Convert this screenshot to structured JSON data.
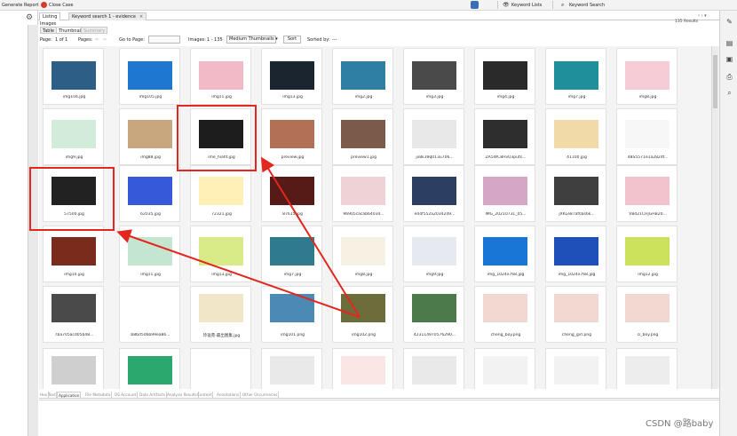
{
  "toolbar": {
    "generate_report": "Generate Report",
    "close_case": "Close Case",
    "keyword_lists": "Keyword Lists",
    "keyword_search": "Keyword Search"
  },
  "tabs": [
    {
      "label": "Listing"
    },
    {
      "label": "Keyword search 1 - evidence"
    }
  ],
  "tab_close": "×",
  "section_label": "Images",
  "right_info": "135 Results",
  "nav_arrows": "‹ ›  ▾",
  "subtabs": [
    "Table",
    "Thumbnail",
    "Summary"
  ],
  "controls": {
    "page_label": "Page:",
    "page_value": "1 of 1",
    "pages_label": "Pages:",
    "goto_label": "Go to Page:",
    "images_label": "Images:",
    "images_value": "1 - 135",
    "size_select": "Medium Thumbnails",
    "sort_button": "Sort",
    "sorted_by_label": "Sorted by:",
    "sorted_by_value": "---"
  },
  "captions": [
    [
      "img104.jpg",
      "img105.jpg",
      "img11.jpg",
      "img13.jpg",
      "img2.jpg",
      "img3.jpg",
      "img4.jpg",
      "img7.jpg",
      "img8.jpg"
    ],
    [
      "img9.jpg",
      "img88.jpg",
      "ime_hiaht.jpg",
      "preview.jpg",
      "preview1.jpg",
      "jx8k39q013u706...",
      "ZA5WC8HvU3puts...",
      "41100.jpg",
      "48S5571e1a282df..."
    ],
    [
      "57500.jpg",
      "62035.jpg",
      "72321.jpg",
      "87615.jpg",
      "96905cacab64034...",
      "e44f552a2034249...",
      "IMG_20210731_05...",
      "jXKLe87af0as6k...",
      "VBd21CHjGHB20..."
    ],
    [
      "img10.jpg",
      "img11.jpg",
      "img13.jpg",
      "img7.jpg",
      "img8.jpg",
      "img9.jpg",
      "img_1024x768.jpg",
      "img_1024x768.jpg",
      "img12.jpg"
    ],
    [
      "7ba705acd05b48...",
      "b8bd5d6b99ea86...",
      "玲珑苑-最出图集.jpg",
      "img101.png",
      "img102.png",
      "423114970576290...",
      "cheng_boy.png",
      "cheng_girl.png",
      "ci_boy.png"
    ],
    [
      "",
      "",
      "",
      "",
      "",
      "",
      "",
      "",
      ""
    ]
  ],
  "thumb_colors": [
    [
      "#2d5f86",
      "#1e78d2",
      "#f2b9c6",
      "#1b2530",
      "#2f7fa3",
      "#4a4a4a",
      "#2a2a2a",
      "#1f8f9c",
      "#f6cdd6"
    ],
    [
      "#d3ecd9",
      "#c9a77e",
      "#1d1d1d",
      "#b27056",
      "#7b5a4a",
      "#e8e8e8",
      "#2e2e2e",
      "#f2d9a8",
      "#f7f7f7"
    ],
    [
      "#222222",
      "#3559d8",
      "#fff1b5",
      "#561b17",
      "#efd2d5",
      "#2c3e62",
      "#d6a6c6",
      "#3f3f3f",
      "#f3c3cd"
    ],
    [
      "#7a2b1c",
      "#c4e6d0",
      "#d9eb88",
      "#2f7a8c",
      "#f7f1e4",
      "#e6e9ef",
      "#1a76d6",
      "#1f4fb8",
      "#cde25c"
    ],
    [
      "#4a4a4a",
      "#ffffff",
      "#f2e6c9",
      "#4c89b5",
      "#6d6d3b",
      "#4c7a4b",
      "#f1d9d2",
      "#f1d9d2",
      "#f1d9d2"
    ],
    [
      "#cfcfcf",
      "#2aa86d",
      "#ffffff",
      "#e9e9e9",
      "#fbe6e6",
      "#e9e9e9",
      "#f2f2f2",
      "#f2f2f2",
      "#ededed"
    ]
  ],
  "bottom_tabs": [
    "Hex",
    "Text",
    "Application",
    "File Metadata",
    "OS Account",
    "Data Artifacts",
    "Analysis Results",
    "Context",
    "Annotations",
    "Other Occurrences"
  ],
  "watermark": "CSDN @路baby",
  "accent_red": "#e3261e"
}
